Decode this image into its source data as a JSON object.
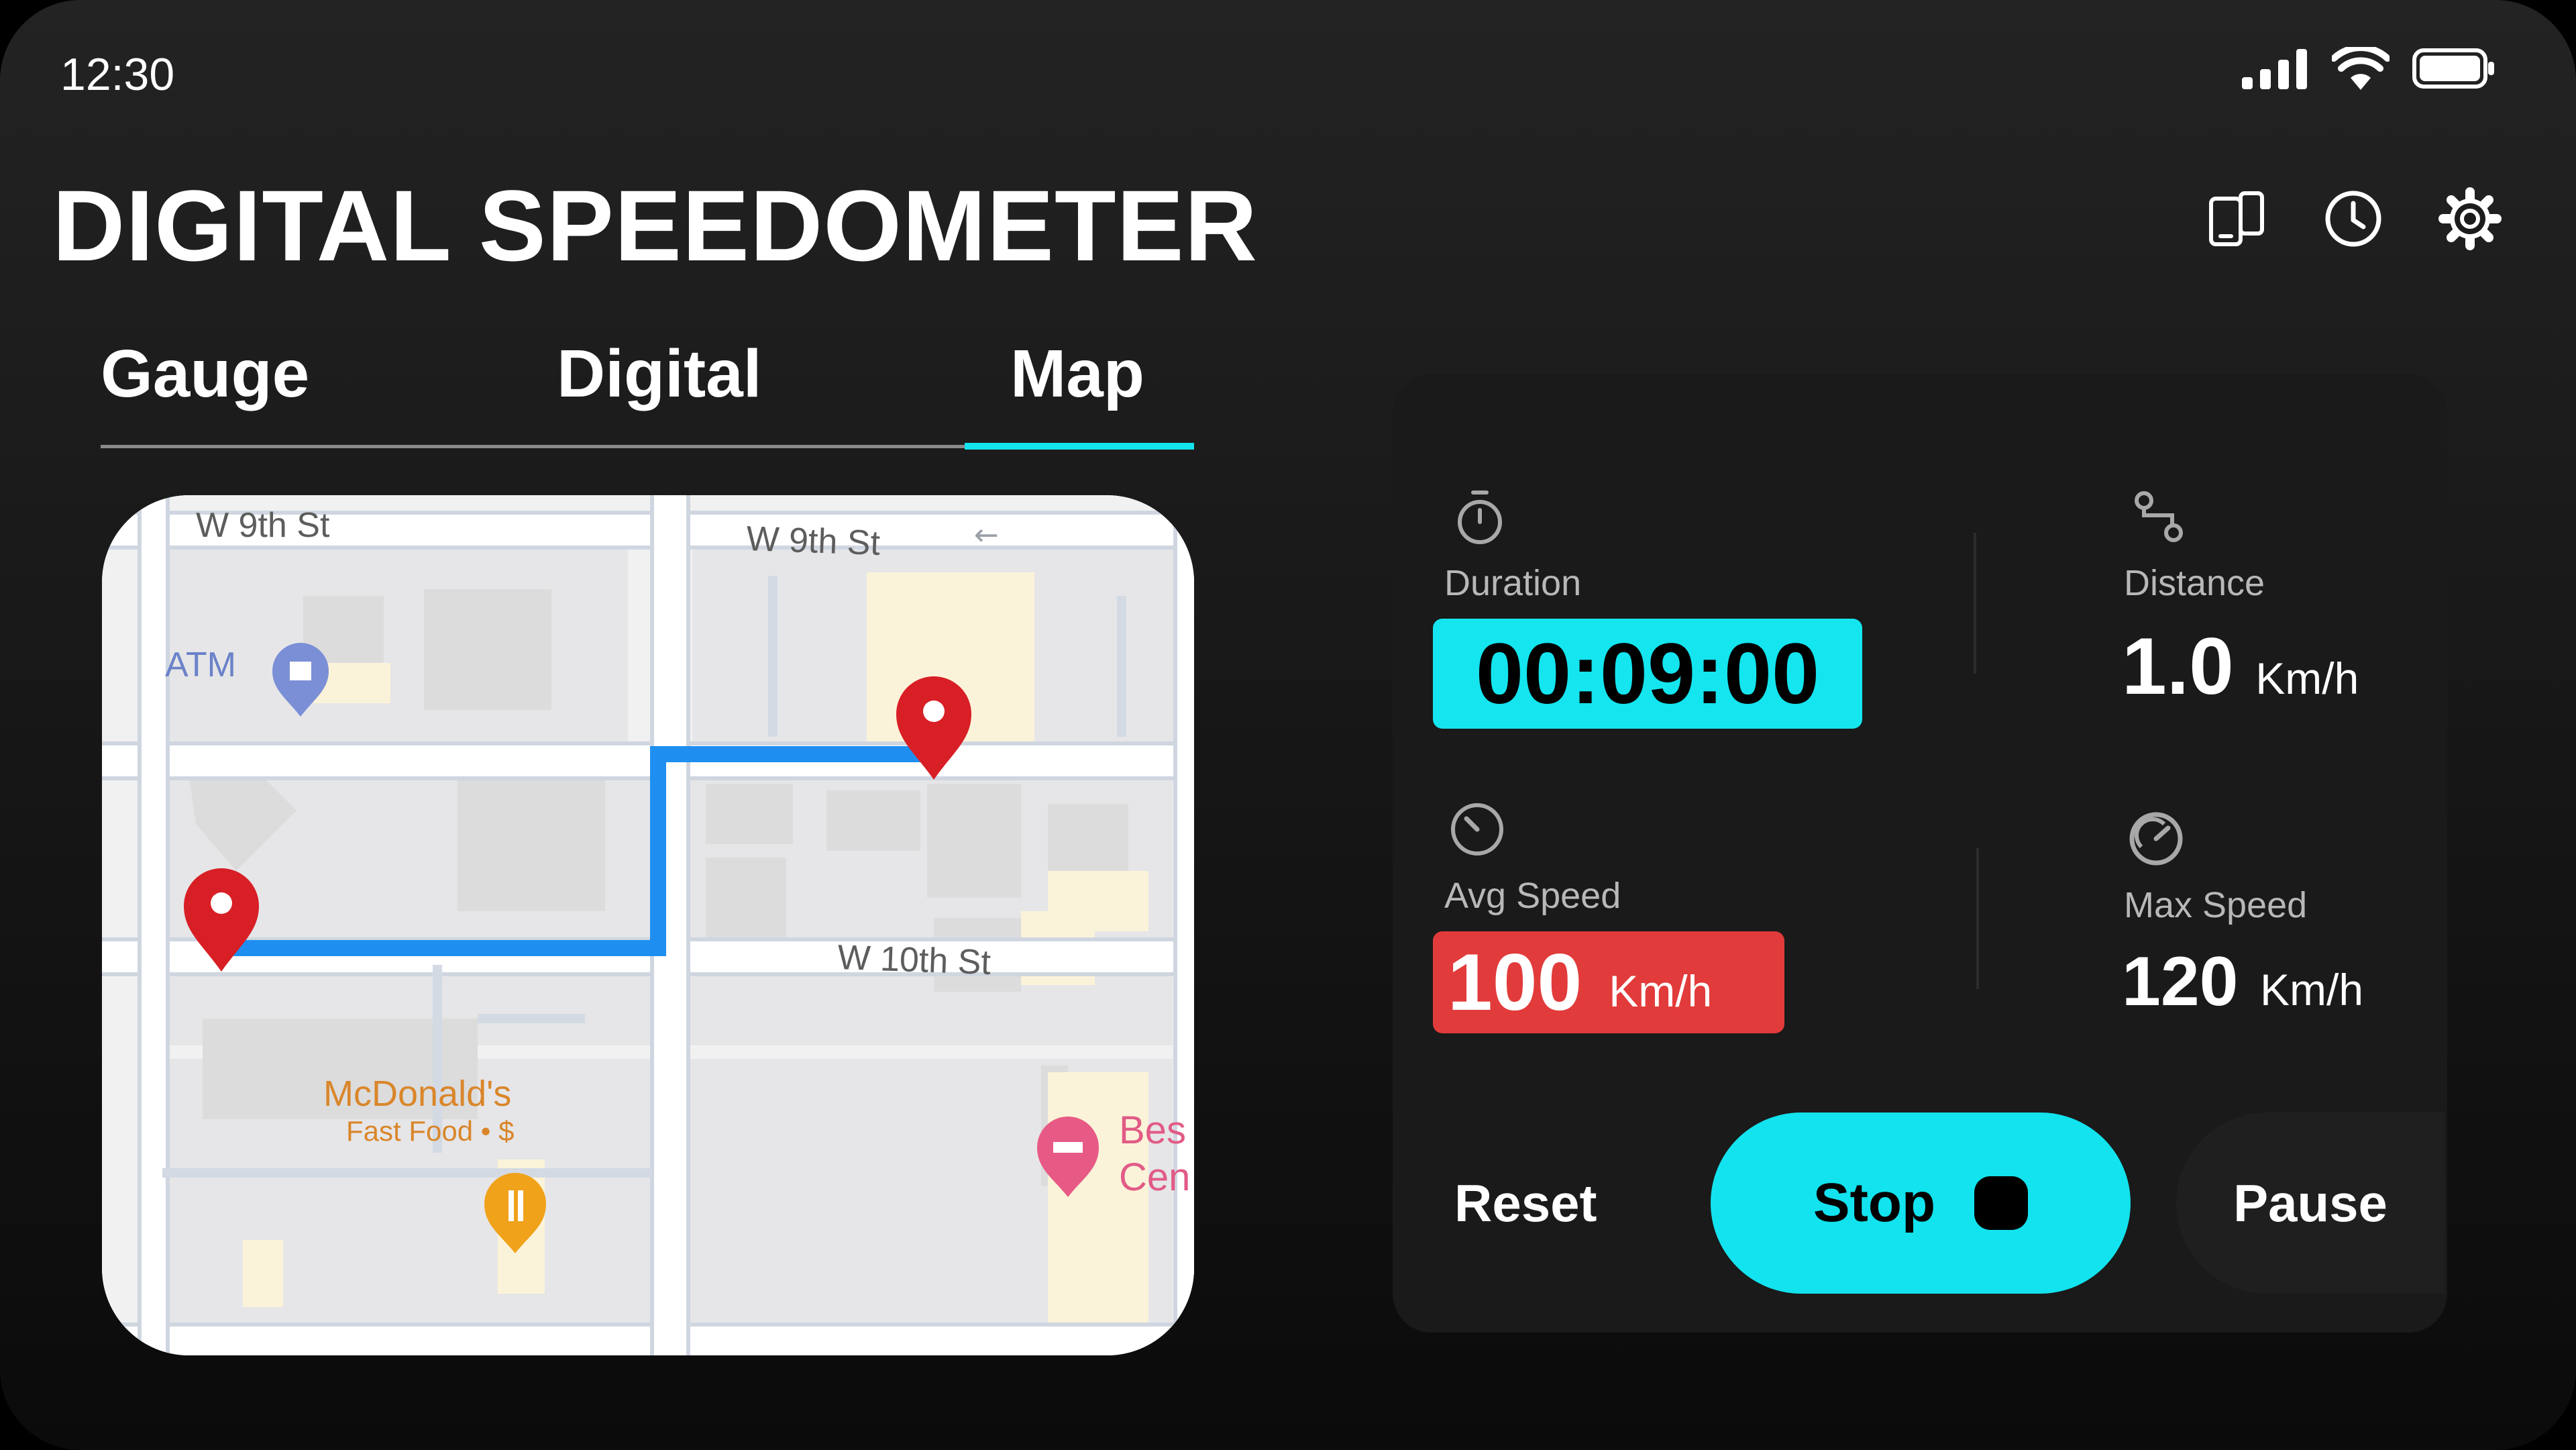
{
  "status": {
    "time": "12:30"
  },
  "app": {
    "title": "DIGITAL SPEEDOMETER"
  },
  "header_actions": [
    "device-switch-icon",
    "history-clock-icon",
    "settings-gear-icon"
  ],
  "tabs": [
    {
      "label": "Gauge",
      "active": false
    },
    {
      "label": "Digital",
      "active": false
    },
    {
      "label": "Map",
      "active": true
    }
  ],
  "map": {
    "streets": {
      "north": "W 9th St",
      "north_right": "W 9th St",
      "south": "W 10th St"
    },
    "pois": {
      "atm": "ATM",
      "restaurant_name": "McDonald's",
      "restaurant_sub": "Fast Food • $",
      "hotel_line1": "Bes",
      "hotel_line2": "Cen"
    },
    "route_color": "#1e8ff0",
    "marker_color": "#d81f26"
  },
  "stats": {
    "duration": {
      "label": "Duration",
      "value": "00:09:00"
    },
    "distance": {
      "label": "Distance",
      "value": "1.0",
      "unit": "Km/h"
    },
    "avg_speed": {
      "label": "Avg Speed",
      "value": "100",
      "unit": "Km/h"
    },
    "max_speed": {
      "label": "Max Speed",
      "value": "120",
      "unit": "Km/h"
    }
  },
  "controls": {
    "reset": "Reset",
    "stop": "Stop",
    "pause": "Pause"
  },
  "colors": {
    "accent": "#12e3ee",
    "danger": "#e23b3b",
    "panel": "#1a1a1a"
  }
}
